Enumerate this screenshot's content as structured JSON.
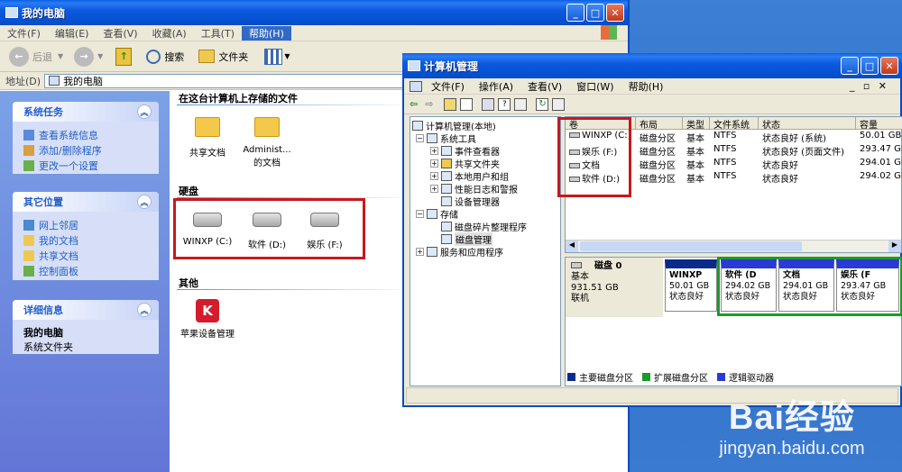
{
  "colors": {
    "primary_partition": "#0a2a8a",
    "extended_partition": "#1a9a28",
    "logical_drive": "#2a3ad8",
    "highlight": "#c8181c"
  },
  "mycomputer": {
    "title": "我的电脑",
    "menu": [
      "文件(F)",
      "编辑(E)",
      "查看(V)",
      "收藏(A)",
      "工具(T)",
      "帮助(H)"
    ],
    "active_menu_index": 5,
    "toolbar": {
      "back": "后退",
      "search": "搜索",
      "folders": "文件夹"
    },
    "address_label": "地址(D)",
    "address_value": "我的电脑",
    "tasks": {
      "system": {
        "title": "系统任务",
        "items": [
          "查看系统信息",
          "添加/删除程序",
          "更改一个设置"
        ]
      },
      "other": {
        "title": "其它位置",
        "items": [
          "网上邻居",
          "我的文档",
          "共享文档",
          "控制面板"
        ]
      },
      "details": {
        "title": "详细信息",
        "name": "我的电脑",
        "desc": "系统文件夹"
      }
    },
    "sections": {
      "stored": {
        "title": "在这台计算机上存储的文件",
        "items": [
          "共享文档",
          "Administ... 的文档"
        ]
      },
      "hdd": {
        "title": "硬盘",
        "items": [
          "WINXP (C:)",
          "软件 (D:)",
          "娱乐 (F:)"
        ]
      },
      "other": {
        "title": "其他",
        "items": [
          "苹果设备管理"
        ]
      }
    }
  },
  "mgmt": {
    "title": "计算机管理",
    "menu": [
      "文件(F)",
      "操作(A)",
      "查看(V)",
      "窗口(W)",
      "帮助(H)"
    ],
    "tree": [
      {
        "label": "计算机管理(本地)"
      },
      {
        "label": "系统工具"
      },
      {
        "label": "事件查看器"
      },
      {
        "label": "共享文件夹"
      },
      {
        "label": "本地用户和组"
      },
      {
        "label": "性能日志和警报"
      },
      {
        "label": "设备管理器"
      },
      {
        "label": "存储"
      },
      {
        "label": "磁盘碎片整理程序"
      },
      {
        "label": "磁盘管理"
      },
      {
        "label": "服务和应用程序"
      }
    ],
    "columns": [
      "卷",
      "布局",
      "类型",
      "文件系统",
      "状态",
      "容量"
    ],
    "volumes": [
      {
        "name": "WINXP (C:)",
        "layout": "磁盘分区",
        "type": "基本",
        "fs": "NTFS",
        "status": "状态良好 (系统)",
        "cap": "50.01 GB"
      },
      {
        "name": "娱乐 (F:)",
        "layout": "磁盘分区",
        "type": "基本",
        "fs": "NTFS",
        "status": "状态良好 (页面文件)",
        "cap": "293.47 GB"
      },
      {
        "name": "文档",
        "layout": "磁盘分区",
        "type": "基本",
        "fs": "NTFS",
        "status": "状态良好",
        "cap": "294.01 GB"
      },
      {
        "name": "软件 (D:)",
        "layout": "磁盘分区",
        "type": "基本",
        "fs": "NTFS",
        "status": "状态良好",
        "cap": "294.02 GB"
      }
    ],
    "disk": {
      "name": "磁盘 0",
      "kind": "基本",
      "size": "931.51 GB",
      "state": "联机"
    },
    "partitions": [
      {
        "name": "WINXP",
        "size": "50.01 GB",
        "status": "状态良好"
      },
      {
        "name": "软件 (D",
        "size": "294.02 GB",
        "status": "状态良好"
      },
      {
        "name": "文档",
        "size": "294.01 GB",
        "status": "状态良好"
      },
      {
        "name": "娱乐 (F",
        "size": "293.47 GB",
        "status": "状态良好"
      }
    ],
    "legend": [
      "主要磁盘分区",
      "扩展磁盘分区",
      "逻辑驱动器"
    ]
  },
  "watermark": {
    "brand": "Bai经验",
    "url": "jingyan.baidu.com"
  }
}
